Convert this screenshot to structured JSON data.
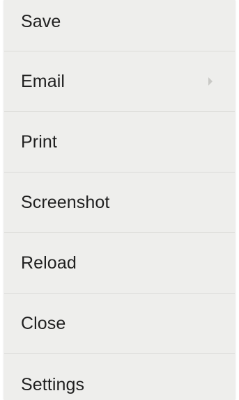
{
  "menu": {
    "items": [
      {
        "label": "Save"
      },
      {
        "label": "Email",
        "has_submenu": true,
        "submenu_icon": "chevron-right-icon"
      },
      {
        "label": "Print"
      },
      {
        "label": "Screenshot"
      },
      {
        "label": "Reload"
      },
      {
        "label": "Close"
      },
      {
        "label": "Settings"
      }
    ]
  },
  "colors": {
    "menu_background": "#eeeeec",
    "divider": "#dcdcd9",
    "text": "#1f1f1f",
    "submenu_arrow": "#c9c9c6"
  }
}
